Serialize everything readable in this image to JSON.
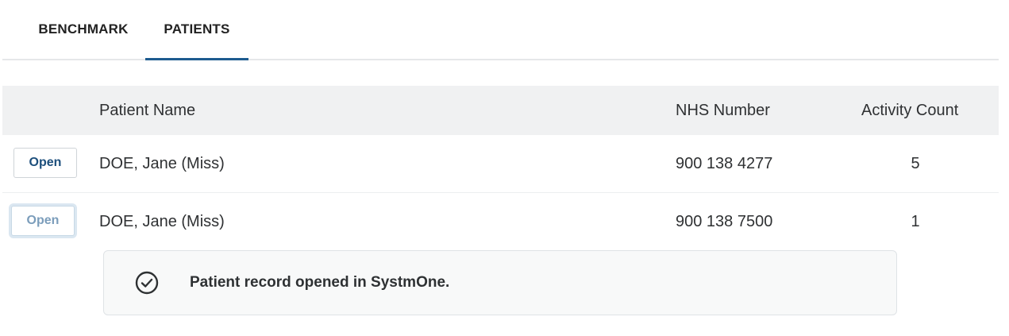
{
  "tabs": {
    "benchmark": "BENCHMARK",
    "patients": "PATIENTS",
    "active": "PATIENTS"
  },
  "table": {
    "headers": {
      "patient_name": "Patient Name",
      "nhs_number": "NHS Number",
      "activity_count": "Activity Count"
    },
    "rows": [
      {
        "action": "Open",
        "patient_name": "DOE, Jane (Miss)",
        "nhs_number": "900 138 4277",
        "activity_count": "5"
      },
      {
        "action": "Open",
        "patient_name": "DOE, Jane (Miss)",
        "nhs_number": "900 138 7500",
        "activity_count": "1"
      }
    ]
  },
  "toast": {
    "icon": "check-circle-icon",
    "message": "Patient record opened in SystmOne."
  },
  "colors": {
    "accent": "#1d5b8f",
    "header_bg": "#f0f1f2",
    "button_text": "#1d4f7c"
  }
}
